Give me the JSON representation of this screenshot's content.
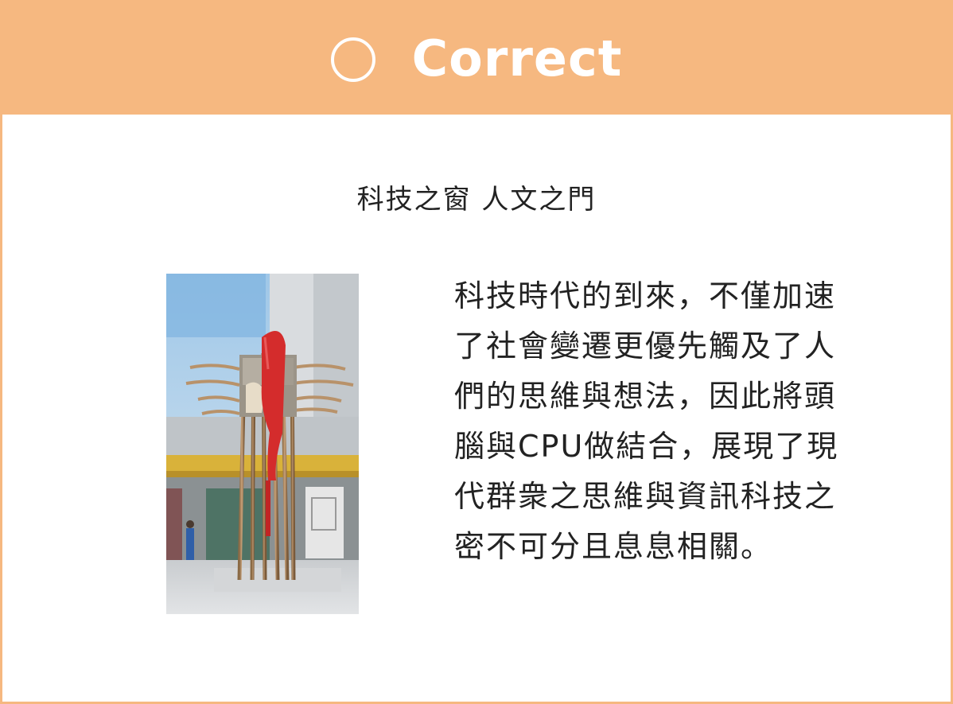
{
  "header": {
    "icon": "circle-icon",
    "label": "Correct",
    "color": "#f6b880"
  },
  "card": {
    "title": "科技之窗 人文之門",
    "image": {
      "name": "sculpture-photo"
    },
    "description": "科技時代的到來，不僅加速了社會變遷更優先觸及了人們的思維與想法，因此將頭腦與CPU做結合，展現了現代群衆之思維與資訊科技之密不可分且息息相關。"
  }
}
